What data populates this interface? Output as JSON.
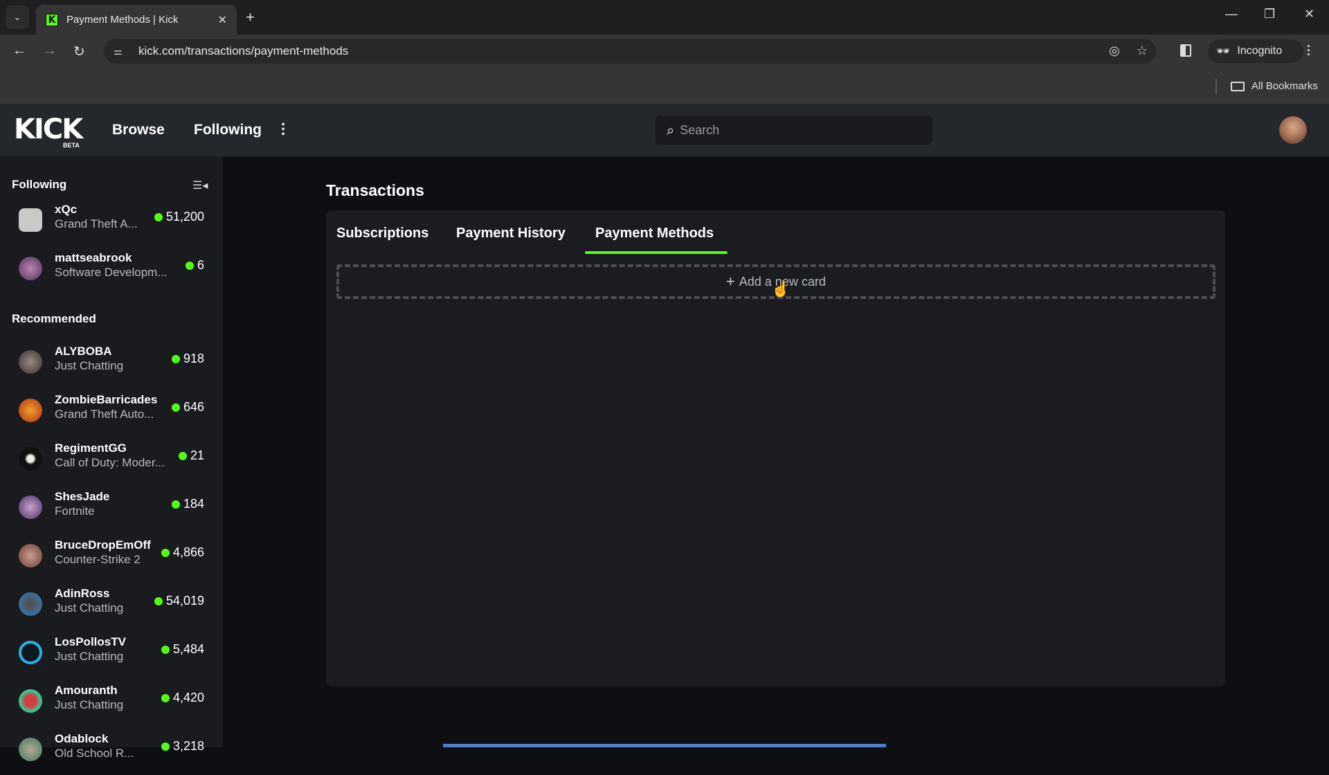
{
  "browser": {
    "tab_title": "Payment Methods | Kick",
    "favicon_letter": "K",
    "url": "kick.com/transactions/payment-methods",
    "incognito_label": "Incognito",
    "all_bookmarks_label": "All Bookmarks",
    "icons": [
      "tab-list-icon",
      "close-tab-icon",
      "new-tab-icon",
      "minimize-icon",
      "restore-icon",
      "close-window-icon",
      "back-icon",
      "forward-icon",
      "reload-icon",
      "site-info-icon",
      "eye-off-icon",
      "star-icon",
      "side-panel-icon",
      "incognito-icon",
      "menu-icon",
      "folder-icon"
    ]
  },
  "header": {
    "logo": "KICK",
    "logo_badge": "BETA",
    "nav": [
      {
        "label": "Browse"
      },
      {
        "label": "Following"
      }
    ],
    "search_placeholder": "Search"
  },
  "sidebar": {
    "following_heading": "Following",
    "recommended_heading": "Recommended",
    "following": [
      {
        "name": "xQc",
        "category": "Grand Theft A...",
        "viewers": "51,200"
      },
      {
        "name": "mattseabrook",
        "category": "Software Developm...",
        "viewers": "6"
      }
    ],
    "recommended": [
      {
        "name": "ALYBOBA",
        "category": "Just Chatting",
        "viewers": "918"
      },
      {
        "name": "ZombieBarricades",
        "category": "Grand Theft Auto...",
        "viewers": "646"
      },
      {
        "name": "RegimentGG",
        "category": "Call of Duty: Moder...",
        "viewers": "21"
      },
      {
        "name": "ShesJade",
        "category": "Fortnite",
        "viewers": "184"
      },
      {
        "name": "BruceDropEmOff",
        "category": "Counter-Strike 2",
        "viewers": "4,866"
      },
      {
        "name": "AdinRoss",
        "category": "Just Chatting",
        "viewers": "54,019"
      },
      {
        "name": "LosPollosTV",
        "category": "Just Chatting",
        "viewers": "5,484"
      },
      {
        "name": "Amouranth",
        "category": "Just Chatting",
        "viewers": "4,420"
      },
      {
        "name": "Odablock",
        "category": "Old School R...",
        "viewers": "3,218"
      }
    ]
  },
  "main": {
    "title": "Transactions",
    "tabs": [
      {
        "label": "Subscriptions",
        "active": false
      },
      {
        "label": "Payment History",
        "active": false
      },
      {
        "label": "Payment Methods",
        "active": true
      }
    ],
    "add_card_label": "Add a new card"
  },
  "colors": {
    "accent": "#53fc18",
    "background": "#0e0f12",
    "panel": "#1a1c20",
    "sidebar": "#191b1f",
    "topnav": "#24272c"
  }
}
